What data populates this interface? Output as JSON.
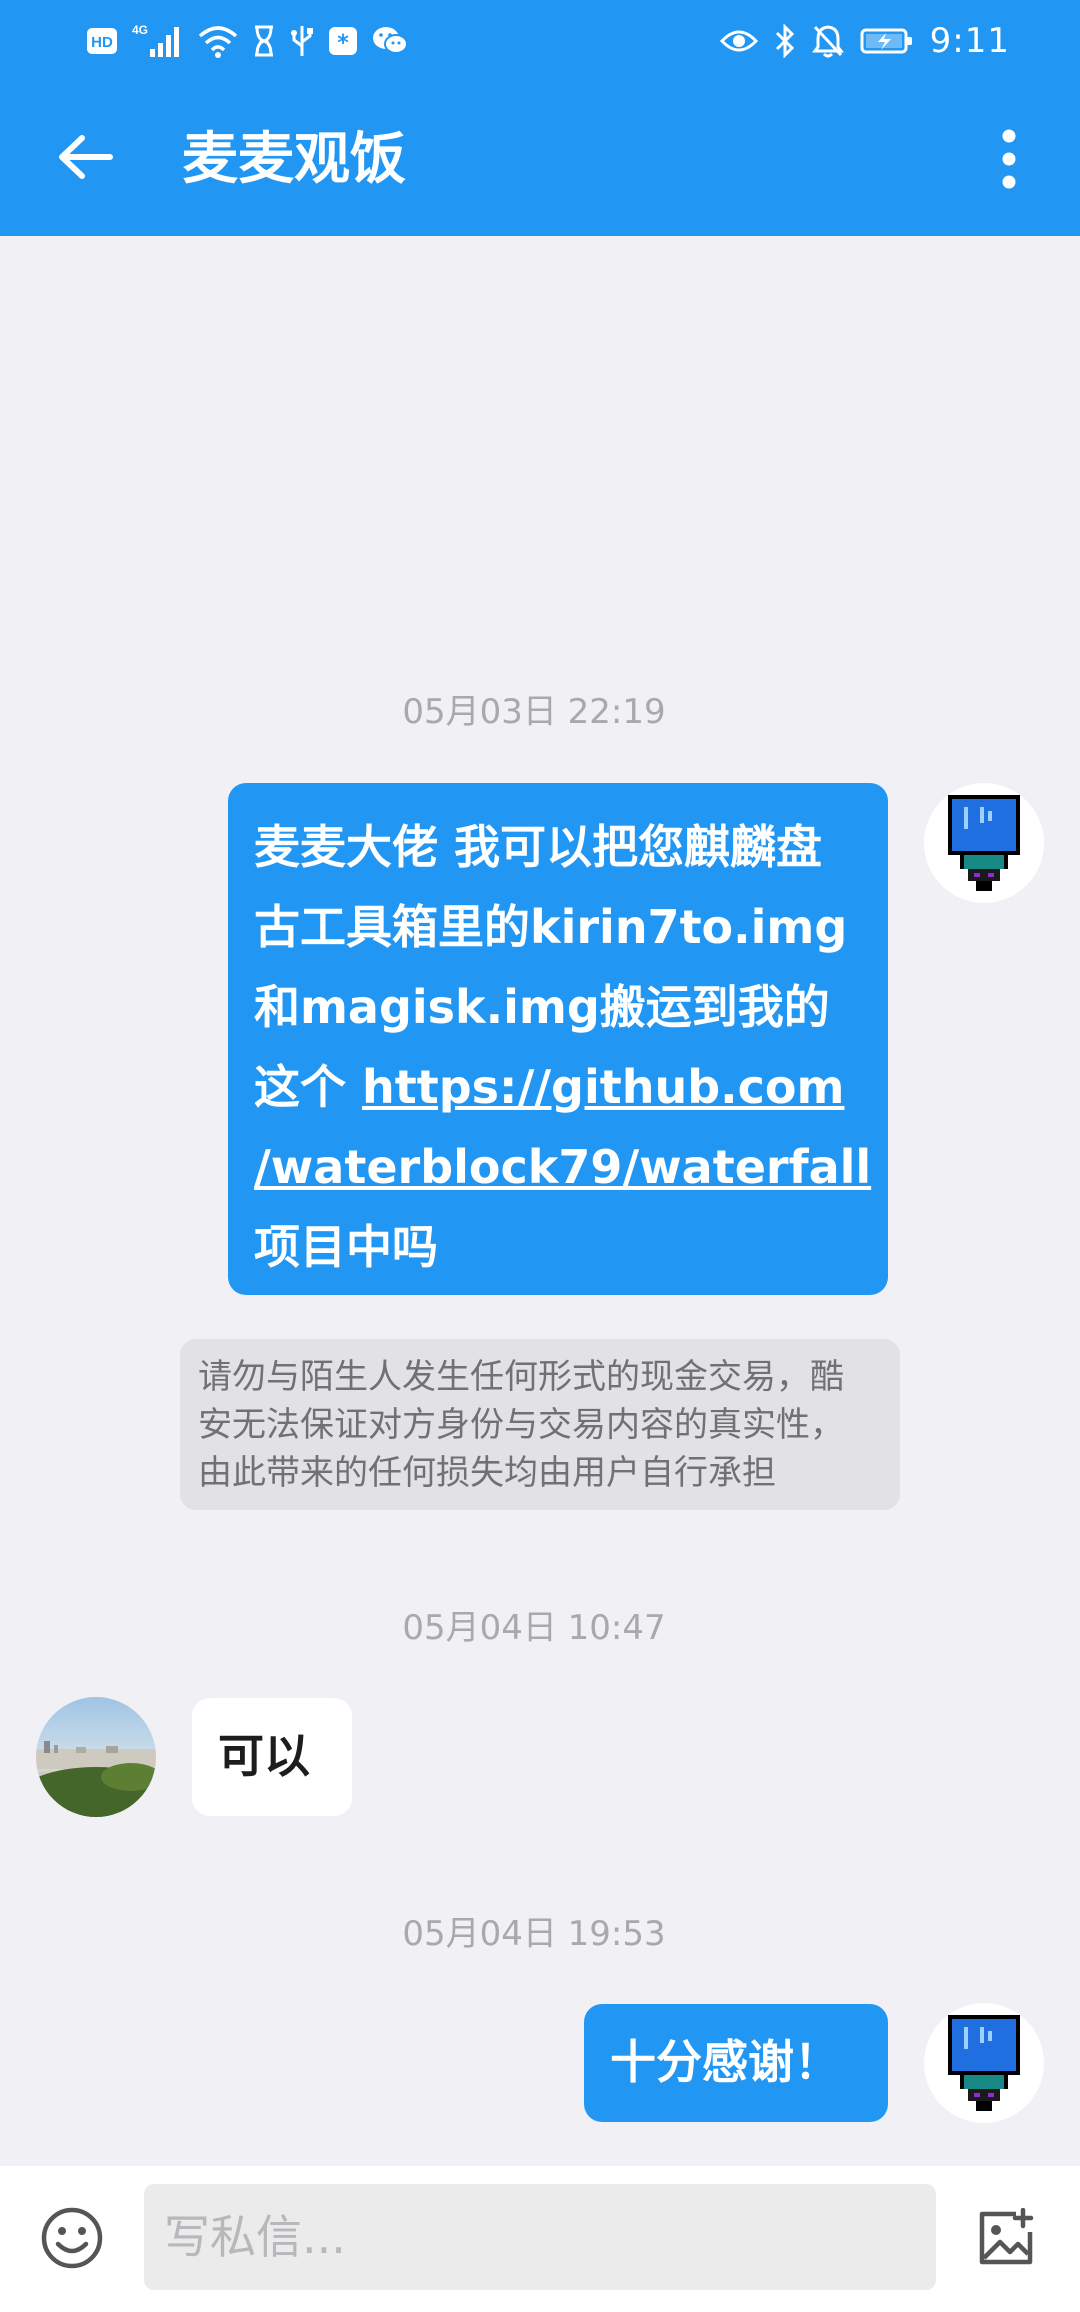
{
  "status_bar": {
    "time": "9:11",
    "network": "4G",
    "hd_badge": "HD",
    "icons_left": [
      "hd-icon",
      "signal-icon",
      "wifi-icon",
      "hourglass-icon",
      "usb-icon",
      "app-notification-icon",
      "wechat-icon"
    ],
    "icons_right": [
      "eye-icon",
      "bluetooth-icon",
      "mute-bell-icon",
      "battery-charging-icon"
    ]
  },
  "app_bar": {
    "title": "麦麦观饭",
    "back_icon": "arrow-left-icon",
    "more_icon": "more-vertical-icon",
    "background": "#2196f3"
  },
  "conversation": {
    "timestamps": [
      "05月03日 22:19",
      "05月04日 10:47",
      "05月04日 19:53"
    ],
    "messages": [
      {
        "sender": "self",
        "line1": "麦麦大佬 我可以把您麒麟盘",
        "line2": "古工具箱里的kirin7to.img",
        "line3": "和magisk.img搬运到我的",
        "line4_prefix": "这个 ",
        "link_part1": "https://github.com",
        "link_part2": "/waterblock79/waterfall",
        "line_end": "项目中吗"
      },
      {
        "sender": "other",
        "text": "可以"
      },
      {
        "sender": "self",
        "text": "十分感谢！"
      }
    ],
    "system_notice": {
      "line1": "请勿与陌生人发生任何形式的现金交易，酷",
      "line2": "安无法保证对方身份与交易内容的真实性，",
      "line3": "由此带来的任何损失均由用户自行承担"
    },
    "bubble_color_self": "#2196f3",
    "bubble_color_other": "#ffffff"
  },
  "input_bar": {
    "placeholder": "写私信...",
    "emoji_icon": "emoji-icon",
    "image_icon": "add-image-icon"
  }
}
